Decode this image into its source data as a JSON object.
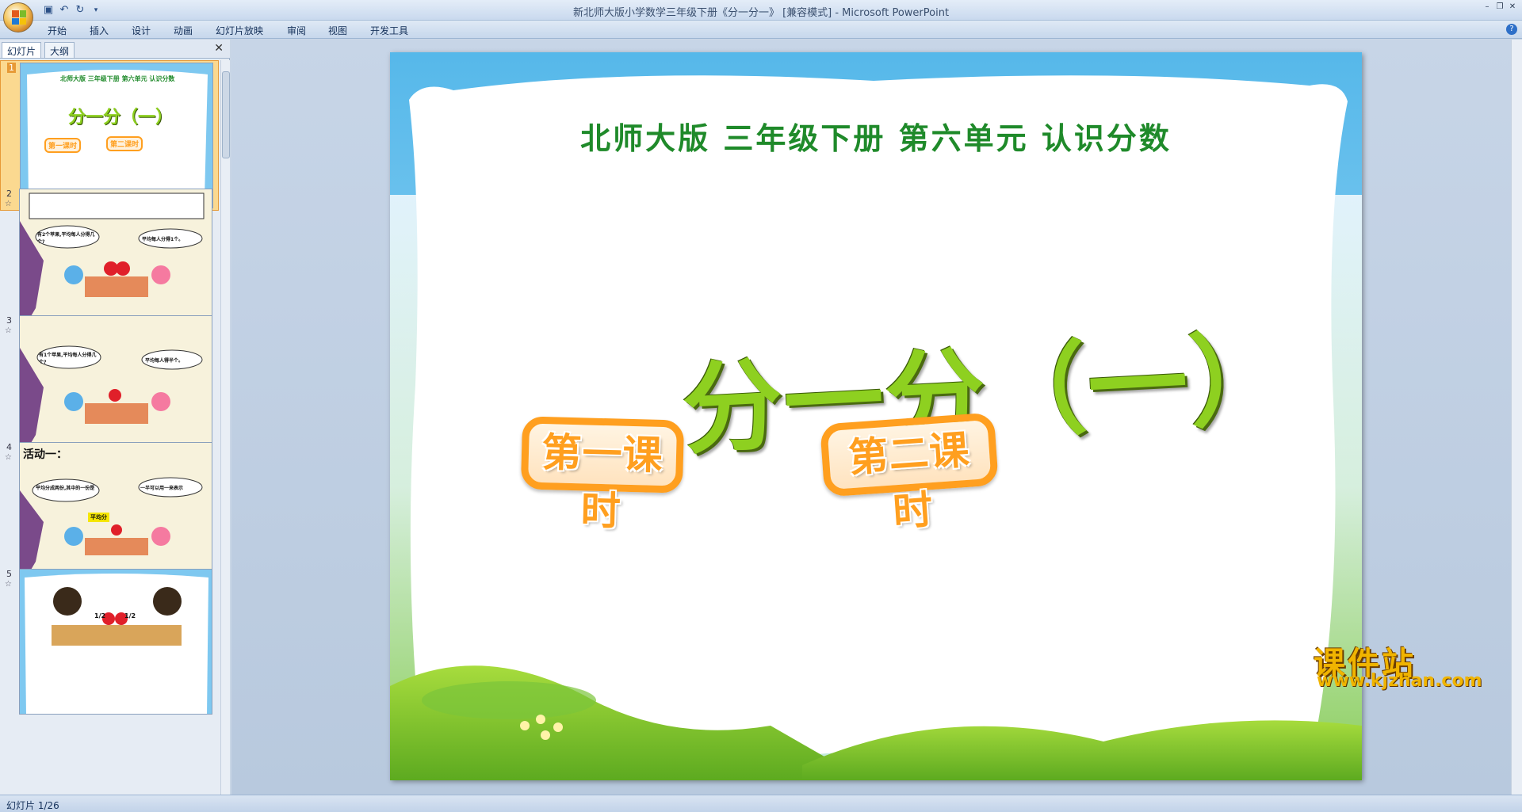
{
  "window": {
    "title": "新北师大版小学数学三年级下册《分一分一》 [兼容模式] - Microsoft PowerPoint"
  },
  "ribbon": {
    "tabs": [
      "开始",
      "插入",
      "设计",
      "动画",
      "幻灯片放映",
      "审阅",
      "视图",
      "开发工具"
    ]
  },
  "side_panel": {
    "tabs": [
      "幻灯片",
      "大纲"
    ],
    "slides": [
      {
        "number": "1",
        "heading": "北师大版 三年级下册 第六单元 认识分数",
        "title": "分一分（一）",
        "btn1": "第一课时",
        "btn2": "第二课时"
      },
      {
        "number": "2",
        "bubble1": "有2个苹果,平均每人分得几个?",
        "bubble2": "平均每人分得1个。"
      },
      {
        "number": "3",
        "bubble1": "有1个苹果,平均每人分得几个?",
        "bubble2": "平均每人得半个。"
      },
      {
        "number": "4",
        "caption": "活动一：",
        "bubble1": "平均分成两份,其中的一份是",
        "bubble2": "一半可以用一来表示",
        "tag": "平均分"
      },
      {
        "number": "5",
        "frac1": "1/2",
        "frac2": "1/2"
      }
    ]
  },
  "slide": {
    "heading": "北师大版  三年级下册  第六单元  认识分数",
    "title": "分一分（一）",
    "lesson1": "第一课时",
    "lesson2": "第二课时"
  },
  "watermark": {
    "top": "课件站",
    "bottom": "www.kjzhan.com"
  },
  "status": {
    "text": "幻灯片 1/26"
  },
  "colors": {
    "heading_green": "#1f8a2a",
    "title_lime": "#8ed020",
    "button_orange": "#ff9f1f"
  }
}
